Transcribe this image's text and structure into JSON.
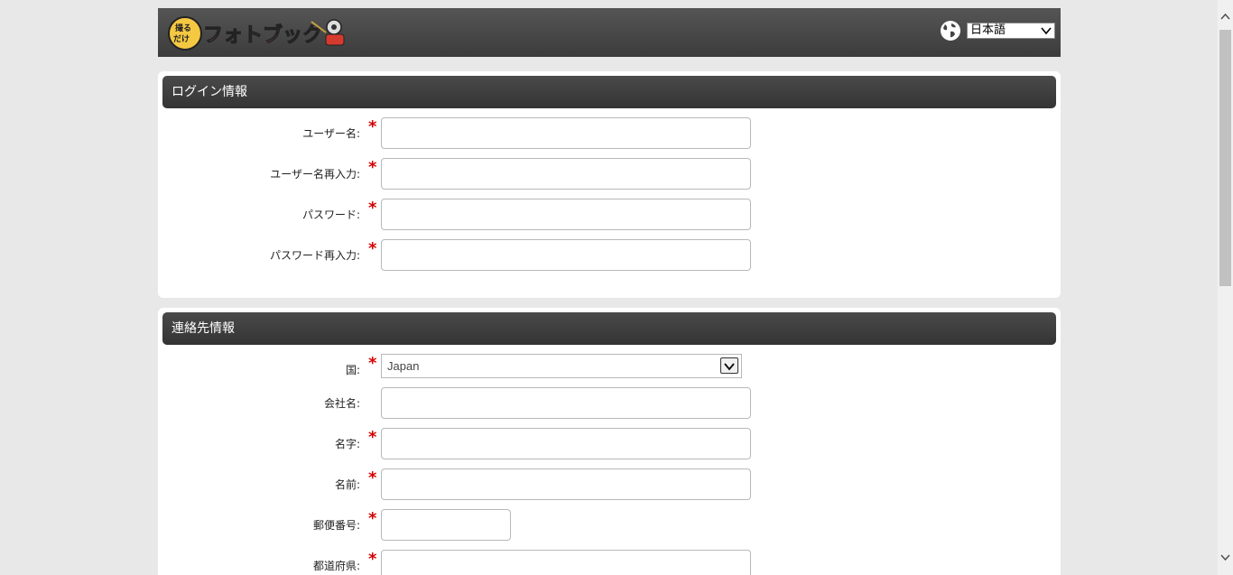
{
  "header": {
    "logo_text": "撮るだけフォトブック",
    "language": "日本語"
  },
  "login_section": {
    "title": "ログイン情報",
    "fields": [
      {
        "label": "ユーザー名:",
        "required": "*"
      },
      {
        "label": "ユーザー名再入力:",
        "required": "*"
      },
      {
        "label": "パスワード:",
        "required": "*"
      },
      {
        "label": "パスワード再入力:",
        "required": "*"
      }
    ]
  },
  "contact_section": {
    "title": "連絡先情報",
    "country": {
      "label": "国:",
      "required": "*",
      "value": "Japan"
    },
    "fields": [
      {
        "label": "会社名:",
        "required": ""
      },
      {
        "label": "名字:",
        "required": "*"
      },
      {
        "label": "名前:",
        "required": "*"
      },
      {
        "label": "郵便番号:",
        "required": "*"
      },
      {
        "label": "都道府県:",
        "required": "*"
      }
    ]
  },
  "colors": {
    "header_bg": "#474747",
    "required_star": "#d40000",
    "page_bg": "#e8e8e8"
  }
}
